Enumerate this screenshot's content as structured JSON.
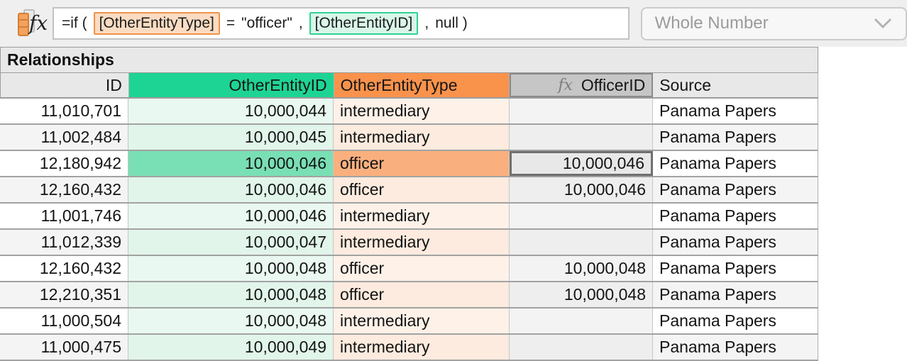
{
  "formula_bar": {
    "fx_label": "fx",
    "formula_parts": [
      {
        "text": "=if (",
        "style": "plain"
      },
      {
        "text": "[OtherEntityType]",
        "style": "token-orange"
      },
      {
        "text": "=",
        "style": "plain"
      },
      {
        "text": "\"officer\"",
        "style": "plain"
      },
      {
        "text": ",",
        "style": "plain"
      },
      {
        "text": "[OtherEntityID]",
        "style": "token-green"
      },
      {
        "text": ",",
        "style": "plain"
      },
      {
        "text": "null )",
        "style": "plain"
      }
    ],
    "type_dropdown": {
      "value": "Whole Number",
      "icon": "chevron-down-icon"
    }
  },
  "table": {
    "title": "Relationships",
    "columns": [
      {
        "label": "ID",
        "align": "right",
        "variant": "plain"
      },
      {
        "label": "OtherEntityID",
        "align": "right",
        "variant": "green"
      },
      {
        "label": "OtherEntityType",
        "align": "left",
        "variant": "orange"
      },
      {
        "label": "OfficerID",
        "align": "right",
        "variant": "formula",
        "fx_prefix": "fx"
      },
      {
        "label": "Source",
        "align": "left",
        "variant": "plain"
      }
    ],
    "rows": [
      {
        "cells": [
          "11,010,701",
          "10,000,044",
          "intermediary",
          "",
          "Panama Papers"
        ]
      },
      {
        "cells": [
          "11,002,484",
          "10,000,045",
          "intermediary",
          "",
          "Panama Papers"
        ]
      },
      {
        "cells": [
          "12,180,942",
          "10,000,046",
          "officer",
          "10,000,046",
          "Panama Papers"
        ]
      },
      {
        "cells": [
          "12,160,432",
          "10,000,046",
          "officer",
          "10,000,046",
          "Panama Papers"
        ]
      },
      {
        "cells": [
          "11,001,746",
          "10,000,046",
          "intermediary",
          "",
          "Panama Papers"
        ]
      },
      {
        "cells": [
          "11,012,339",
          "10,000,047",
          "intermediary",
          "",
          "Panama Papers"
        ]
      },
      {
        "cells": [
          "12,160,432",
          "10,000,048",
          "officer",
          "10,000,048",
          "Panama Papers"
        ]
      },
      {
        "cells": [
          "12,210,351",
          "10,000,048",
          "officer",
          "10,000,048",
          "Panama Papers"
        ]
      },
      {
        "cells": [
          "11,000,504",
          "10,000,048",
          "intermediary",
          "",
          "Panama Papers"
        ]
      },
      {
        "cells": [
          "11,000,475",
          "10,000,049",
          "intermediary",
          "",
          "Panama Papers"
        ]
      }
    ],
    "selection": {
      "row_index": 2,
      "column": "OfficerID",
      "selected_value": "10,000,046"
    }
  },
  "colors": {
    "header_green": "#1ed494",
    "header_orange": "#f9924b",
    "row_highlight_green": "#79dfb5",
    "row_highlight_orange": "#fab07e",
    "token_orange_bg": "#fbdcc2",
    "token_orange_border": "#ef9347",
    "token_green_bg": "#d9f6e9",
    "token_green_border": "#2ed592",
    "selected_cell_border": "#6f6f6f"
  }
}
